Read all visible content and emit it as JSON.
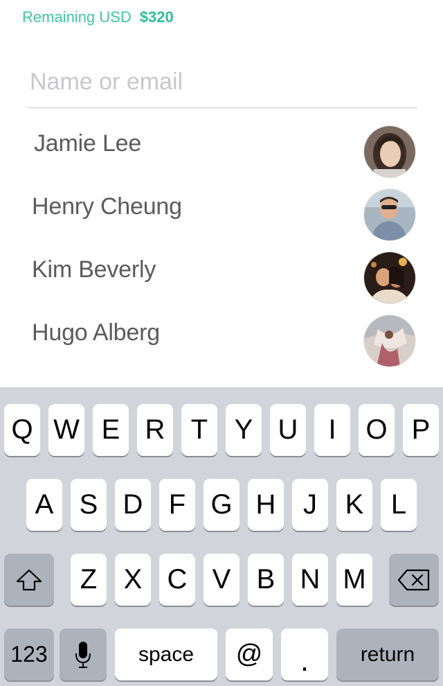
{
  "balance": {
    "label": "Remaining USD",
    "amount": "$320"
  },
  "search": {
    "placeholder": "Name or email",
    "value": ""
  },
  "contacts": [
    {
      "name": "Jamie Lee",
      "avatar": "profile-photo"
    },
    {
      "name": "Henry Cheung",
      "avatar": "profile-photo"
    },
    {
      "name": "Kim Beverly",
      "avatar": "profile-photo"
    },
    {
      "name": "Hugo Alberg",
      "avatar": "profile-photo"
    }
  ],
  "keyboard": {
    "row1": [
      "Q",
      "W",
      "E",
      "R",
      "T",
      "Y",
      "U",
      "I",
      "O",
      "P"
    ],
    "row2": [
      "A",
      "S",
      "D",
      "F",
      "G",
      "H",
      "J",
      "K",
      "L"
    ],
    "row3": [
      "Z",
      "X",
      "C",
      "V",
      "B",
      "N",
      "M"
    ],
    "shift_icon": "shift-arrow-icon",
    "delete_icon": "backspace-icon",
    "numbers_label": "123",
    "mic_icon": "microphone-icon",
    "space_label": "space",
    "at_label": "@",
    "period_label": ".",
    "return_label": "return"
  },
  "colors": {
    "accent": "#2ebf95",
    "keyboard_bg": "#d1d5db",
    "key_light": "#ffffff",
    "key_dark": "#adb3bc"
  }
}
